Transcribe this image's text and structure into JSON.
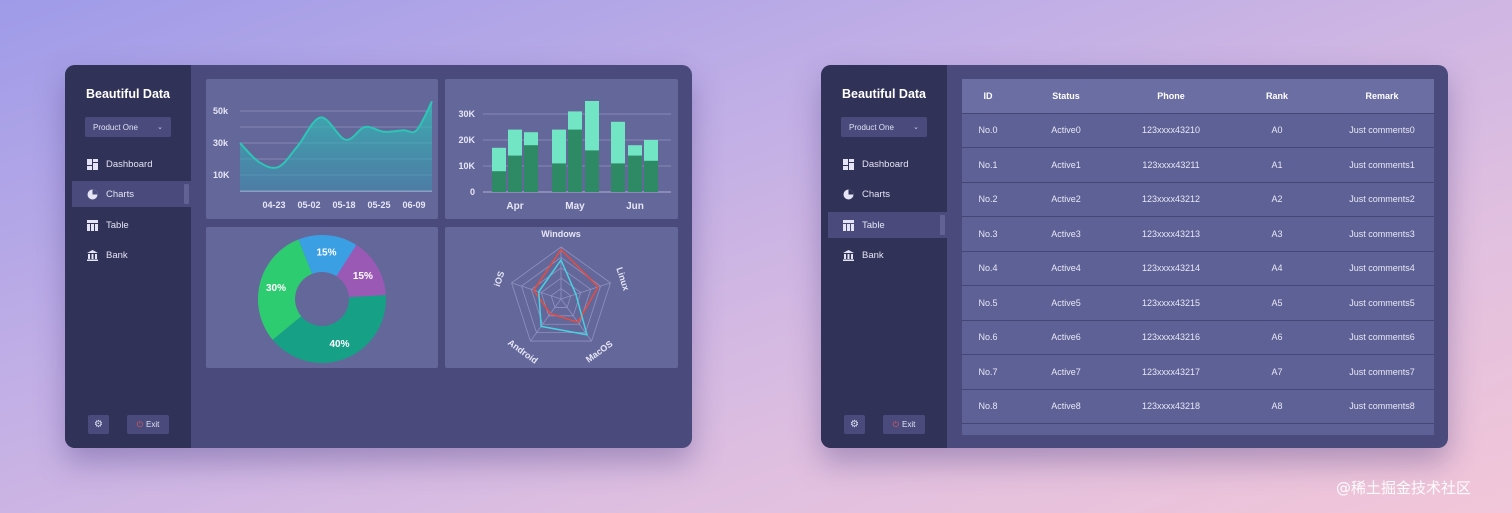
{
  "left_window": {
    "brand": "Beautiful Data",
    "product_select": "Product One",
    "nav": [
      {
        "label": "Dashboard",
        "icon": "dashboard-icon"
      },
      {
        "label": "Charts",
        "icon": "pie-chart-icon",
        "active": true
      },
      {
        "label": "Table",
        "icon": "table-icon"
      },
      {
        "label": "Bank",
        "icon": "bank-icon"
      }
    ],
    "exit_label": "Exit"
  },
  "right_window": {
    "brand": "Beautiful Data",
    "product_select": "Product One",
    "nav": [
      {
        "label": "Dashboard",
        "icon": "dashboard-icon"
      },
      {
        "label": "Charts",
        "icon": "pie-chart-icon"
      },
      {
        "label": "Table",
        "icon": "table-icon",
        "active": true
      },
      {
        "label": "Bank",
        "icon": "bank-icon"
      }
    ],
    "exit_label": "Exit",
    "table": {
      "columns": [
        "ID",
        "Status",
        "Phone",
        "Rank",
        "Remark"
      ],
      "rows": [
        [
          "No.0",
          "Active0",
          "123xxxx43210",
          "A0",
          "Just comments0"
        ],
        [
          "No.1",
          "Active1",
          "123xxxx43211",
          "A1",
          "Just comments1"
        ],
        [
          "No.2",
          "Active2",
          "123xxxx43212",
          "A2",
          "Just comments2"
        ],
        [
          "No.3",
          "Active3",
          "123xxxx43213",
          "A3",
          "Just comments3"
        ],
        [
          "No.4",
          "Active4",
          "123xxxx43214",
          "A4",
          "Just comments4"
        ],
        [
          "No.5",
          "Active5",
          "123xxxx43215",
          "A5",
          "Just comments5"
        ],
        [
          "No.6",
          "Active6",
          "123xxxx43216",
          "A6",
          "Just comments6"
        ],
        [
          "No.7",
          "Active7",
          "123xxxx43217",
          "A7",
          "Just comments7"
        ],
        [
          "No.8",
          "Active8",
          "123xxxx43218",
          "A8",
          "Just comments8"
        ]
      ]
    }
  },
  "watermark": "@稀土掘金技术社区",
  "colors": {
    "background_start": "#9f9be8",
    "background_end": "#f2c6d8",
    "window": "#4a4b7c",
    "sidebar": "#313258",
    "panel": "#64679a",
    "teal": "#2ec4b6",
    "bar_light": "#72e5c4",
    "bar_dark": "#2e8a64",
    "pie_blue": "#3aa0e3",
    "pie_purple": "#9b59b6",
    "pie_teal": "#16a085",
    "pie_green": "#2ecc71",
    "radar_red": "#e74c3c",
    "radar_cyan": "#48d1e0"
  },
  "chart_data": [
    {
      "type": "area",
      "x_ticks": [
        "04-23",
        "05-02",
        "05-18",
        "05-25",
        "06-09"
      ],
      "y_ticks": [
        "10K",
        "30k",
        "50k"
      ],
      "x": [
        0,
        0.1,
        0.2,
        0.3,
        0.42,
        0.55,
        0.65,
        0.75,
        0.85,
        0.92,
        1.0
      ],
      "values": [
        30,
        18,
        15,
        28,
        46,
        32,
        40,
        37,
        38,
        38,
        56
      ],
      "ylim": [
        0,
        60
      ]
    },
    {
      "type": "bar",
      "categories": [
        "Apr",
        "May",
        "Jun"
      ],
      "y_ticks": [
        "0",
        "10K",
        "20K",
        "30K"
      ],
      "ylim": [
        0,
        35
      ],
      "series": [
        {
          "values": [
            17,
            24,
            23,
            24,
            31,
            35,
            27,
            18,
            20
          ]
        },
        {
          "values": [
            8,
            14,
            18,
            11,
            24,
            16,
            11,
            14,
            12
          ]
        }
      ]
    },
    {
      "type": "pie",
      "labels": [
        "15%",
        "15%",
        "40%",
        "30%"
      ],
      "values": [
        15,
        15,
        40,
        30
      ]
    },
    {
      "type": "radar",
      "axes": [
        "Windows",
        "Linux",
        "MacOS",
        "Android",
        "iOS"
      ],
      "series": [
        {
          "values": [
            95,
            75,
            55,
            35,
            55
          ]
        },
        {
          "values": [
            75,
            30,
            85,
            65,
            45
          ]
        }
      ]
    }
  ]
}
